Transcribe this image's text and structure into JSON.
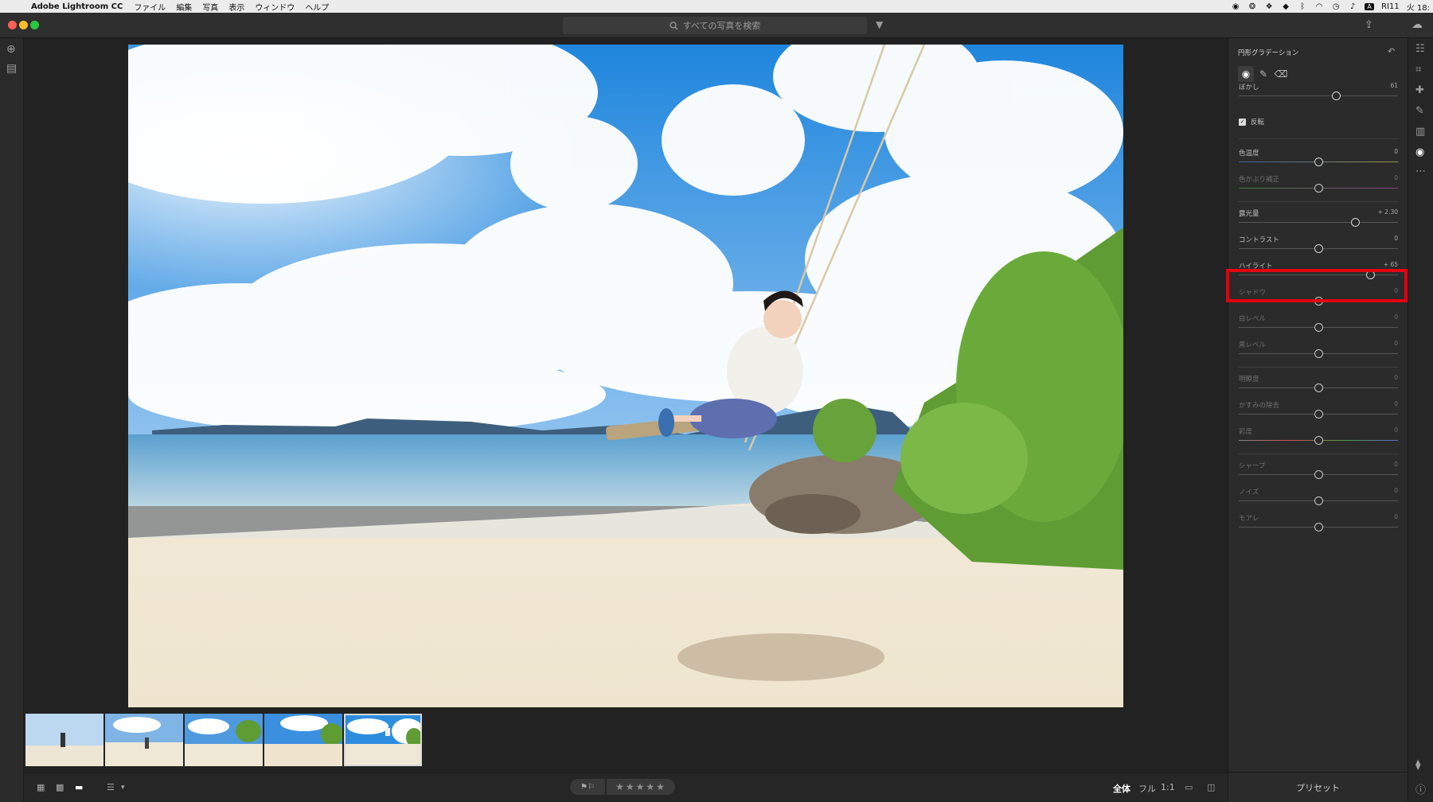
{
  "menubar": {
    "app_name": "Adobe Lightroom CC",
    "menus": [
      "ファイル",
      "編集",
      "写真",
      "表示",
      "ウィンドウ",
      "ヘルプ"
    ],
    "status_user": "RI11",
    "status_time": "火 18:",
    "status_input": "A"
  },
  "toolbar": {
    "search_placeholder": "すべての写真を検索"
  },
  "panel": {
    "title": "円形グラデーション",
    "feather": {
      "label": "ぼかし",
      "value": "61",
      "level": 0.61
    },
    "invert": {
      "label": "反転",
      "checked": true,
      "check_glyph": "✓"
    },
    "groups": [
      [
        {
          "label": "色温度",
          "value": "0",
          "level": 0.5,
          "dim": false
        },
        {
          "label": "色かぶり補正",
          "value": "0",
          "level": 0.5,
          "dim": true
        }
      ],
      [
        {
          "label": "露光量",
          "value": "+ 2.30",
          "level": 0.73,
          "dim": false
        },
        {
          "label": "コントラスト",
          "value": "0",
          "level": 0.5,
          "dim": false
        },
        {
          "label": "ハイライト",
          "value": "+ 65",
          "level": 0.825,
          "dim": false
        },
        {
          "label": "シャドウ",
          "value": "0",
          "level": 0.5,
          "dim": true
        },
        {
          "label": "白レベル",
          "value": "0",
          "level": 0.5,
          "dim": true
        },
        {
          "label": "黒レベル",
          "value": "0",
          "level": 0.5,
          "dim": true
        }
      ],
      [
        {
          "label": "明瞭度",
          "value": "0",
          "level": 0.5,
          "dim": true
        },
        {
          "label": "かすみの除去",
          "value": "0",
          "level": 0.5,
          "dim": true
        },
        {
          "label": "彩度",
          "value": "0",
          "level": 0.5,
          "dim": true
        }
      ],
      [
        {
          "label": "シャープ",
          "value": "0",
          "level": 0.5,
          "dim": true
        },
        {
          "label": "ノイズ",
          "value": "0",
          "level": 0.5,
          "dim": true
        },
        {
          "label": "モアレ",
          "value": "0",
          "level": 0.5,
          "dim": true
        }
      ]
    ],
    "presets_label": "プリセット"
  },
  "bottombar": {
    "rating_stars": "★★★★★",
    "flag_glyphs": "⚑⚐",
    "view_modes": [
      "全体",
      "フル",
      "1:1"
    ],
    "selected_view": "全体"
  },
  "colors": {
    "highlight_outline": "#e3000f",
    "panel_bg": "#2b2b2b",
    "sky": "#2d8ee0"
  }
}
